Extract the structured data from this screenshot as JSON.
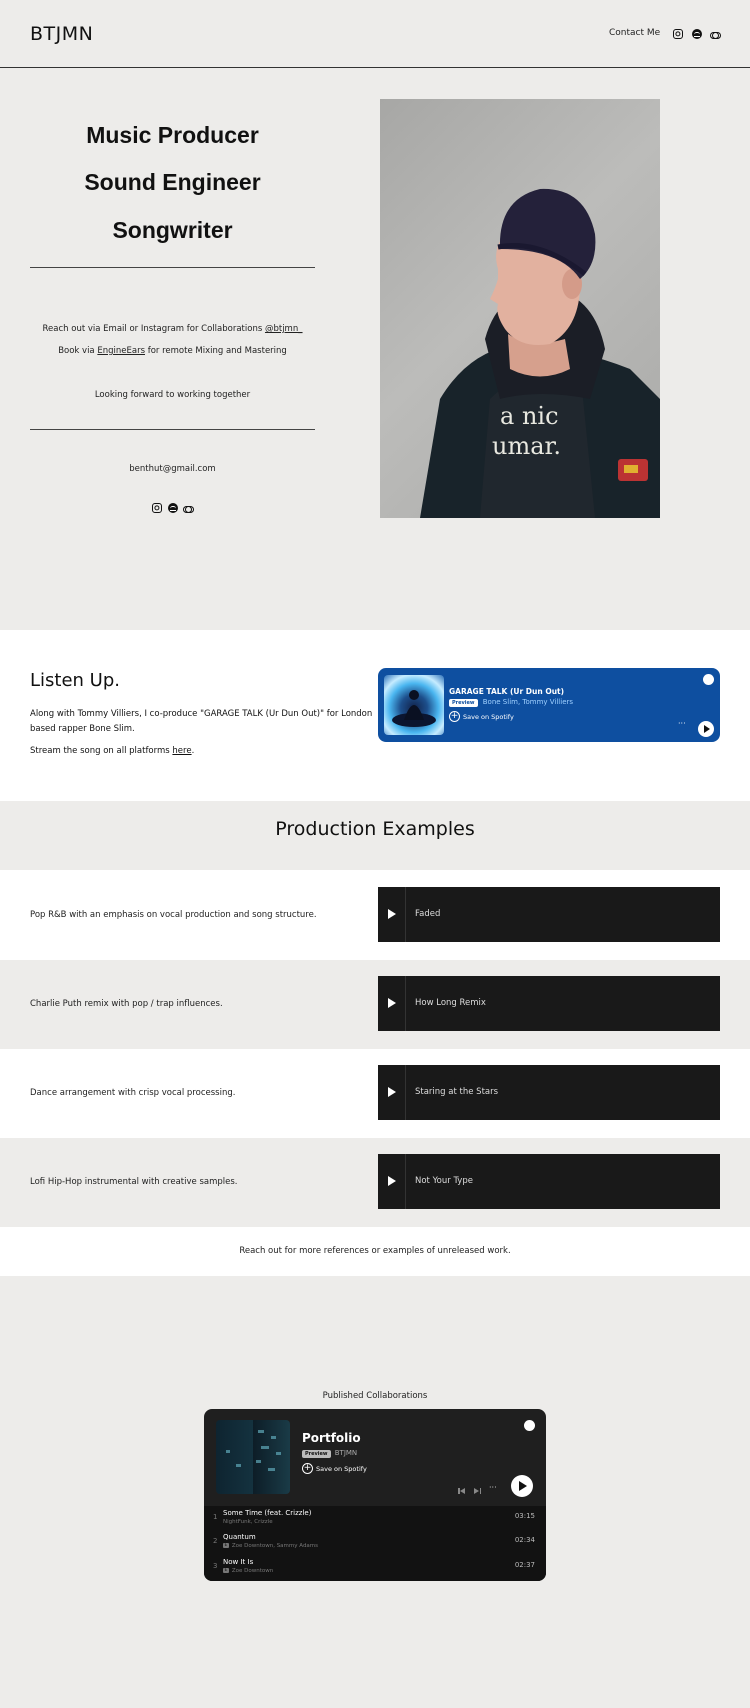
{
  "header": {
    "logo": "BTJMN",
    "contact_label": "Contact Me",
    "icons": [
      "instagram-icon",
      "spotify-icon",
      "link-icon"
    ]
  },
  "hero": {
    "roles": [
      "Music Producer",
      "Sound Engineer",
      "Songwriter"
    ],
    "collab_text": "Reach out via Email or Instagram for Collaborations",
    "instagram_handle": "@btjmn_",
    "book_prefix": "Book via",
    "book_link": "EngineEars",
    "book_suffix": "for remote Mixing and Mastering",
    "closing": "Looking forward to working together",
    "email": "benthut@gmail.com",
    "photo_alt": "Portrait photo"
  },
  "listen": {
    "title": "Listen Up.",
    "paragraph": "Along with Tommy Villiers, I co-produce \"GARAGE TALK (Ur Dun Out)\" for London based rapper Bone Slim.",
    "stream_prefix": "Stream the song on all platforms",
    "stream_link": "here",
    "stream_suffix": ".",
    "embed": {
      "title": "GARAGE TALK (Ur Dun Out)",
      "badge": "Preview",
      "artists": "Bone Slim, Tommy Villiers",
      "save": "Save on Spotify",
      "more": "···",
      "accent": "#0e4fa0"
    }
  },
  "production": {
    "title": "Production Examples",
    "rows": [
      {
        "desc": "Pop R&B with an emphasis on vocal production and song structure.",
        "track": "Faded"
      },
      {
        "desc": "Charlie Puth remix with pop / trap influences.",
        "track": "How Long Remix"
      },
      {
        "desc": "Dance arrangement with crisp vocal processing.",
        "track": "Staring at the Stars"
      },
      {
        "desc": "Lofi Hip-Hop instrumental with creative samples.",
        "track": "Not Your Type"
      }
    ],
    "reach_out": "Reach out for more references or examples of unreleased work."
  },
  "published": {
    "label": "Published Collaborations",
    "playlist": {
      "title": "Portfolio",
      "badge": "Preview",
      "owner": "BTJMN",
      "save": "Save on Spotify",
      "more": "···",
      "tracks": [
        {
          "num": "1",
          "name": "Some Time (feat. Crizzle)",
          "artist": "NightFunk, Crizzle",
          "explicit": "",
          "duration": "03:15"
        },
        {
          "num": "2",
          "name": "Quantum",
          "artist": "Zoe Downtown, Sammy Adams",
          "explicit": "E",
          "duration": "02:34"
        },
        {
          "num": "3",
          "name": "Now It Is",
          "artist": "Zoe Downtown",
          "explicit": "E",
          "duration": "02:37"
        }
      ]
    }
  }
}
